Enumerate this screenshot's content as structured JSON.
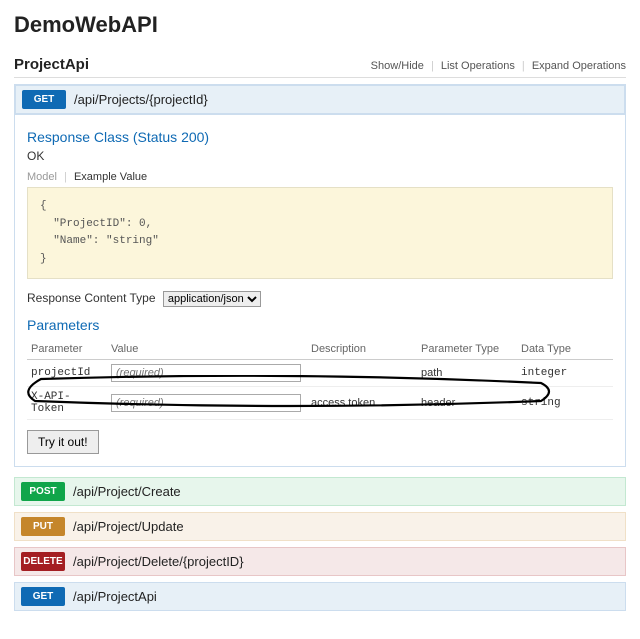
{
  "page_title": "DemoWebAPI",
  "api_name": "ProjectApi",
  "header_links": {
    "show_hide": "Show/Hide",
    "list_ops": "List Operations",
    "expand_ops": "Expand Operations"
  },
  "expanded": {
    "method": "GET",
    "path": "/api/Projects/{projectId}",
    "response_class_title": "Response Class (Status 200)",
    "ok": "OK",
    "model_tab": "Model",
    "example_tab": "Example Value",
    "example_json": "{\n  \"ProjectID\": 0,\n  \"Name\": \"string\"\n}",
    "rct_label": "Response Content Type",
    "rct_value": "application/json",
    "params_title": "Parameters",
    "headers": {
      "parameter": "Parameter",
      "value": "Value",
      "description": "Description",
      "param_type": "Parameter Type",
      "data_type": "Data Type"
    },
    "rows": [
      {
        "name": "projectId",
        "placeholder": "(required)",
        "description": "",
        "param_type": "path",
        "data_type": "integer"
      },
      {
        "name": "X-API-Token",
        "placeholder": "(required)",
        "description": "access token",
        "param_type": "header",
        "data_type": "string"
      }
    ],
    "try_label": "Try it out!"
  },
  "other_ops": [
    {
      "method": "POST",
      "path": "/api/Project/Create"
    },
    {
      "method": "PUT",
      "path": "/api/Project/Update"
    },
    {
      "method": "DELETE",
      "path": "/api/Project/Delete/{projectID}"
    },
    {
      "method": "GET",
      "path": "/api/ProjectApi"
    }
  ],
  "chart_data": {
    "type": "table",
    "title": "Parameters",
    "columns": [
      "Parameter",
      "Value",
      "Description",
      "Parameter Type",
      "Data Type"
    ],
    "rows": [
      [
        "projectId",
        "(required)",
        "",
        "path",
        "integer"
      ],
      [
        "X-API-Token",
        "(required)",
        "access token",
        "header",
        "string"
      ]
    ]
  }
}
